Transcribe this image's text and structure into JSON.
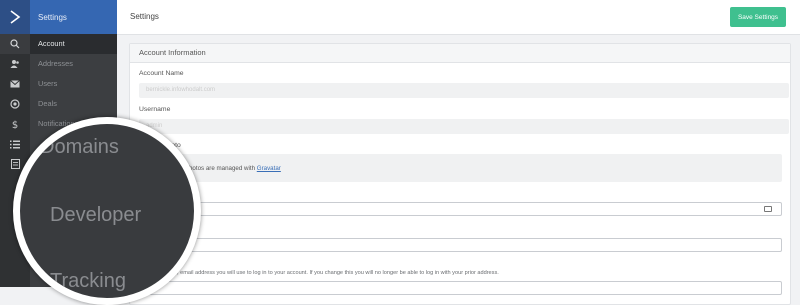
{
  "rail": {
    "icons": [
      "search-icon",
      "contacts-icon",
      "mail-icon",
      "target-icon",
      "dollar-icon",
      "list-icon",
      "report-icon"
    ]
  },
  "menu": {
    "header": "Settings",
    "items": [
      "Account",
      "Addresses",
      "Users",
      "Deals",
      "Notifications"
    ]
  },
  "topbar": {
    "title": "Settings",
    "save_label": "Save Settings"
  },
  "panel": {
    "title": "Account Information",
    "account_name_label": "Account Name",
    "account_name_value": "bernickle.infowhodalt.com",
    "username_label": "Username",
    "username_value": "admin",
    "photo_label": "Photo",
    "gravatar_text": "le photos are managed with",
    "gravatar_link": "Gravatar",
    "email_help": ", email address you will use to log in to your account. If you change this you will no longer be able to log in with your prior address."
  },
  "magnifier": {
    "items": [
      "Domains",
      "Developer",
      "Tracking"
    ]
  },
  "colors": {
    "brand": "#3567b2",
    "accent_button": "#3fc08f",
    "sidebar_dark": "#3c3e41"
  }
}
